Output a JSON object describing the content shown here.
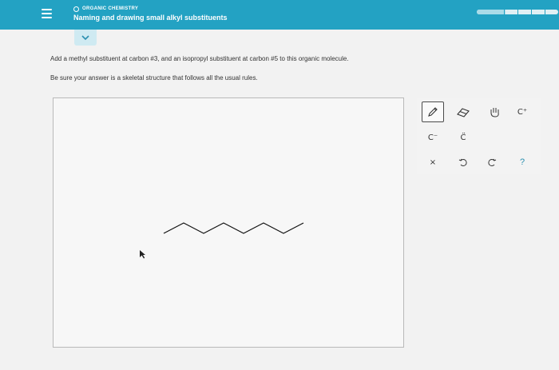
{
  "header": {
    "course_label": "ORGANIC CHEMISTRY",
    "title": "Naming and drawing small alkyl substituents",
    "progress_fraction": 0.35
  },
  "question": {
    "instruction": "Add a methyl substituent at carbon #3, and an isopropyl substituent at carbon #5 to this organic molecule.",
    "note": "Be sure your answer is a skeletal structure that follows all the usual rules."
  },
  "tools": {
    "pencil_icon": "pencil-icon",
    "eraser_icon": "eraser-icon",
    "hand_icon": "hand-icon",
    "carbocation_label": "C⁺",
    "carbanion_label": "C⁻",
    "lone_pair_label": "C̈",
    "clear_label": "×",
    "undo_icon": "undo-icon",
    "redo_icon": "redo-icon",
    "help_label": "?"
  },
  "colors": {
    "header": "#23a2c3",
    "accent": "#2b8fb0"
  }
}
